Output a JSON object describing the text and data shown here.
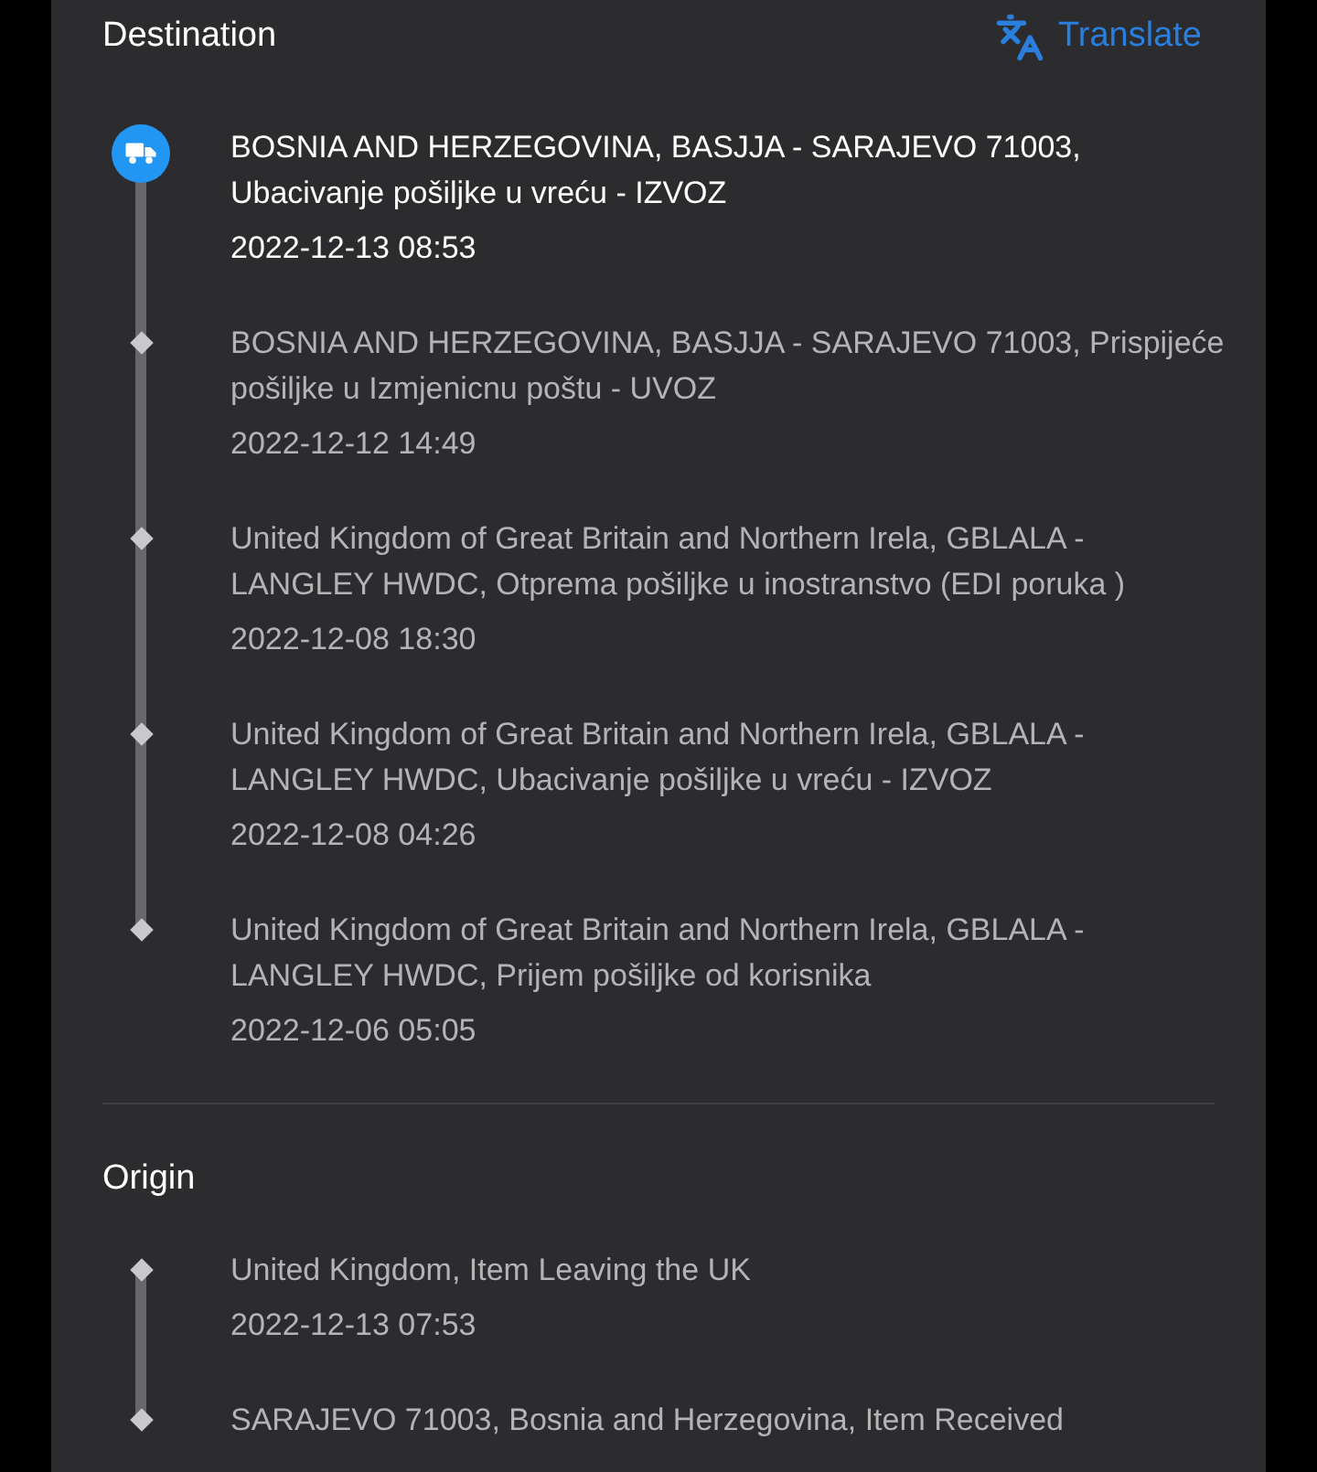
{
  "sections": [
    {
      "title": "Destination",
      "action": {
        "label": "Translate"
      },
      "events": [
        {
          "current": true,
          "description": "BOSNIA AND HERZEGOVINA, BASJJA - SARAJEVO 71003, Ubacivanje pošiljke u vreću - IZVOZ",
          "time": "2022-12-13 08:53"
        },
        {
          "current": false,
          "description": "BOSNIA AND HERZEGOVINA, BASJJA - SARAJEVO 71003, Prispijeće pošiljke u Izmjenicnu poštu - UVOZ",
          "time": "2022-12-12 14:49"
        },
        {
          "current": false,
          "description": "United Kingdom of Great Britain and Northern Irela, GBLALA - LANGLEY HWDC, Otprema pošiljke u inostranstvo (EDI poruka )",
          "time": "2022-12-08 18:30"
        },
        {
          "current": false,
          "description": "United Kingdom of Great Britain and Northern Irela, GBLALA - LANGLEY HWDC, Ubacivanje pošiljke u vreću - IZVOZ",
          "time": "2022-12-08 04:26"
        },
        {
          "current": false,
          "description": "United Kingdom of Great Britain and Northern Irela, GBLALA - LANGLEY HWDC, Prijem pošiljke od korisnika",
          "time": "2022-12-06 05:05"
        }
      ]
    },
    {
      "title": "Origin",
      "events": [
        {
          "current": false,
          "description": "United Kingdom, Item Leaving the UK",
          "time": "2022-12-13 07:53"
        },
        {
          "current": false,
          "description": "SARAJEVO 71003, Bosnia and Herzegovina, Item Received"
        }
      ]
    }
  ]
}
